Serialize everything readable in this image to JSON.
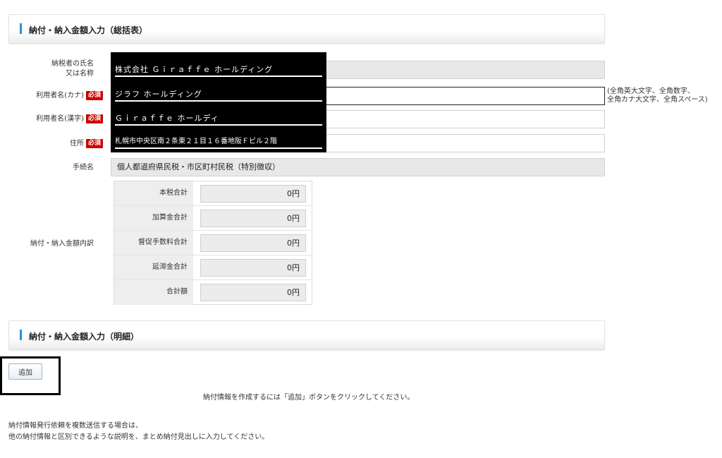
{
  "summary_section": {
    "title": "納付・納入金額入力（総括表）"
  },
  "taxpayer": {
    "label_line1": "納税者の氏名",
    "label_line2": "又は名称",
    "value": ""
  },
  "user_kana": {
    "label": "利用者名(カナ)",
    "required": "必須",
    "value": "",
    "hint_line1": "(全角英大文字、全角数字、",
    "hint_line2": "全角カナ大文字、全角スペース)"
  },
  "user_kanji": {
    "label": "利用者名(漢字)",
    "required": "必須",
    "value": ""
  },
  "address": {
    "label": "住所",
    "required": "必須",
    "value": ""
  },
  "procedure": {
    "label": "手続名",
    "value": "個人都道府県民税・市区町村民税（特別徴収）"
  },
  "redacted_overlay": {
    "line1": "株式会社 Ｇｉｒａｆｆｅ ホールディング",
    "line2": "ジラフ ホールディング",
    "line3": "Ｇｉｒａｆｆｅ ホールディ",
    "line4": "札幌市中央区南２条東２１目１６番地阪Ｆビル２階"
  },
  "breakdown": {
    "label": "納付・納入金額内訳",
    "rows": [
      {
        "label": "本税合計",
        "value": "0円"
      },
      {
        "label": "加算金合計",
        "value": "0円"
      },
      {
        "label": "督促手数料合計",
        "value": "0円"
      },
      {
        "label": "延滞金合計",
        "value": "0円"
      },
      {
        "label": "合計額",
        "value": "0円"
      }
    ]
  },
  "detail_section": {
    "title": "納付・納入金額入力（明細）"
  },
  "add_button": {
    "label": "追加"
  },
  "add_instruction": "納付情報を作成するには「追加」ボタンをクリックしてください。",
  "bulk_note": {
    "line1": "納付情報発行依頼を複数送信する場合は、",
    "line2": "他の納付情報と区別できるような説明を、まとめ納付見出しに入力してください。"
  },
  "colors": {
    "accent_bar": "#2b8fd6",
    "required_badge": "#cc0000",
    "readonly_bg": "#e8e8e8"
  }
}
